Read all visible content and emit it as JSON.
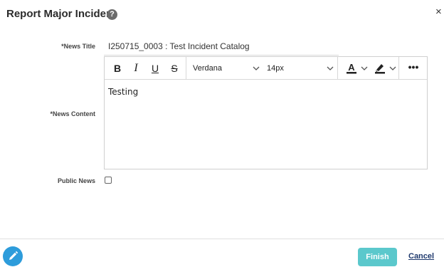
{
  "dialog": {
    "title": "Report Major Incident",
    "help_icon": "question-circle-icon",
    "help_glyph": "?",
    "close_icon": "close-icon",
    "close_glyph": "×"
  },
  "form": {
    "news_title_label": "*News Title",
    "news_title_value": "I250715_0003 : Test Incident Catalog",
    "news_content_label": "*News Content",
    "public_news_label": "Public News",
    "public_news_checked": false
  },
  "editor": {
    "toolbar": {
      "bold": "B",
      "italic": "I",
      "underline": "U",
      "strikethrough": "S",
      "font_family": "Verdana",
      "font_size": "14px",
      "text_color_glyph": "A",
      "more_glyph": "•••"
    },
    "content": "Testing"
  },
  "footer": {
    "edit_icon": "pencil-icon",
    "finish_label": "Finish",
    "cancel_label": "Cancel"
  },
  "colors": {
    "accent": "#5bc8cc",
    "fab": "#2d9cdb",
    "cancel_link": "#1f3a6e"
  }
}
